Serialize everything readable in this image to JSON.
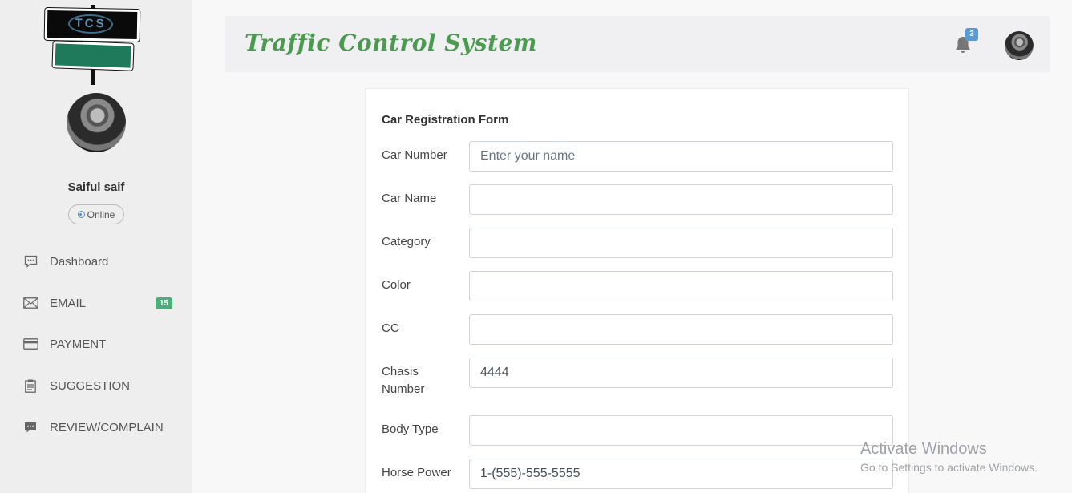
{
  "logo": {
    "text": "TCS"
  },
  "profile": {
    "name": "Saiful saif",
    "status": "Online"
  },
  "nav": [
    {
      "label": "Dashboard",
      "icon": "chat-icon"
    },
    {
      "label": "EMAIL",
      "icon": "mail-icon",
      "badge": "15"
    },
    {
      "label": "PAYMENT",
      "icon": "credit-card-icon"
    },
    {
      "label": "SUGGESTION",
      "icon": "clipboard-icon"
    },
    {
      "label": "REVIEW/COMPLAIN",
      "icon": "comment-icon"
    }
  ],
  "header": {
    "title": "Traffic Control System",
    "notification_count": "3"
  },
  "form": {
    "title": "Car Registration Form",
    "fields": [
      {
        "label": "Car Number",
        "value": "",
        "placeholder": "Enter your name"
      },
      {
        "label": "Car Name",
        "value": "",
        "placeholder": ""
      },
      {
        "label": "Category",
        "value": "",
        "placeholder": ""
      },
      {
        "label": "Color",
        "value": "",
        "placeholder": ""
      },
      {
        "label": "CC",
        "value": "",
        "placeholder": ""
      },
      {
        "label": "Chasis Number",
        "value": "4444",
        "placeholder": ""
      },
      {
        "label": "Body Type",
        "value": "",
        "placeholder": ""
      },
      {
        "label": "Horse Power",
        "value": "1-(555)-555-5555",
        "placeholder": ""
      }
    ]
  },
  "watermark": {
    "line1": "Activate Windows",
    "line2": "Go to Settings to activate Windows."
  },
  "colors": {
    "accent_green": "#4a9a4f",
    "badge_green": "#4cae7a",
    "badge_blue": "#5b9bd5"
  }
}
